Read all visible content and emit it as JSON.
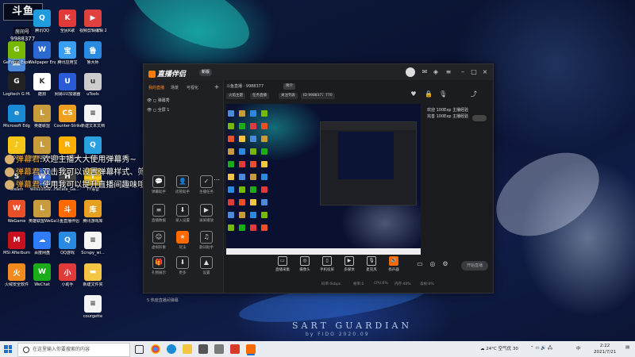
{
  "overlay": {
    "logo": "斗鱼",
    "room_label": "房间号",
    "room_number": "9988377"
  },
  "danmaku": [
    {
      "name": "弹幕君",
      "text": "欢迎主播大大使用弹幕秀~"
    },
    {
      "name": "弹幕君",
      "text": "双击我可以设置弹幕样式、筛选展示哦~"
    },
    {
      "name": "弹幕君",
      "text": "使用我可以提升直播间趣味哦(*^0^#)"
    }
  ],
  "desktop_icons": [
    {
      "label": "此电脑",
      "color": "#4a8ad8",
      "glyph": "💻"
    },
    {
      "label": "GeForce Experience",
      "color": "#76b900",
      "glyph": "G"
    },
    {
      "label": "Logitech G HUB",
      "color": "#222222",
      "glyph": "G"
    },
    {
      "label": "Microsoft Edge",
      "color": "#1a8ad4",
      "glyph": "e"
    },
    {
      "label": "QQ音乐",
      "color": "#f5c518",
      "glyph": "♪"
    },
    {
      "label": "Steam",
      "color": "#1b2838",
      "glyph": "S"
    },
    {
      "label": "WeGame",
      "color": "#e8502a",
      "glyph": "W"
    },
    {
      "label": "MSI Afterburner",
      "color": "#c8101e",
      "glyph": "M"
    },
    {
      "label": "火绒安全软件",
      "color": "#f08a1c",
      "glyph": "火"
    },
    {
      "label": "腾讯QQ",
      "color": "#1f9bde",
      "glyph": "Q"
    },
    {
      "label": "Wallpaper Engine",
      "color": "#2a6ad0",
      "glyph": "W"
    },
    {
      "label": "酷狗",
      "color": "#ffffff",
      "glyph": "K"
    },
    {
      "label": "英雄联盟",
      "color": "#c89b3c",
      "glyph": "L"
    },
    {
      "label": "英雄联盟WeGame版",
      "color": "#c89b3c",
      "glyph": "L"
    },
    {
      "label": "WIN10ISW...",
      "color": "#3b6ed8",
      "glyph": "W"
    },
    {
      "label": "英雄联盟WeGame版",
      "color": "#c89b3c",
      "glyph": "L"
    },
    {
      "label": "百度网盘",
      "color": "#2f7cf6",
      "glyph": "☁"
    },
    {
      "label": "WeChat",
      "color": "#1aad19",
      "glyph": "W"
    },
    {
      "label": "全民K歌",
      "color": "#e23a3a",
      "glyph": "K"
    },
    {
      "label": "腾讯应用宝",
      "color": "#3a9ff0",
      "glyph": "宝"
    },
    {
      "label": "网易UU加速器",
      "color": "#2a5bd7",
      "glyph": "U"
    },
    {
      "label": "Counter-Strike Global Off...",
      "color": "#f0a020",
      "glyph": "CS"
    },
    {
      "label": "Rockstar Games...",
      "color": "#fbb000",
      "glyph": "R"
    },
    {
      "label": "Hecate_Ga... Center 2.0",
      "color": "#444444",
      "glyph": "H"
    },
    {
      "label": "斗鱼直播伴侣",
      "color": "#ff6a00",
      "glyph": "斗"
    },
    {
      "label": "QQ游戏",
      "color": "#2a8ae0",
      "glyph": "Q"
    },
    {
      "label": "小助手",
      "color": "#e03a3a",
      "glyph": "小"
    },
    {
      "label": "视频剪辑编辑 20210707...",
      "color": "#e04040",
      "glyph": "▶"
    },
    {
      "label": "鲁大师",
      "color": "#2a8ae0",
      "glyph": "鲁"
    },
    {
      "label": "uTools",
      "color": "#cccccc",
      "glyph": "u"
    },
    {
      "label": "新建文本文档",
      "color": "#f4f4f4",
      "glyph": "≡"
    },
    {
      "label": "QQ",
      "color": "#2aa0e0",
      "glyph": "Q"
    },
    {
      "label": "YY语音",
      "color": "#f5c518",
      "glyph": "Y"
    },
    {
      "label": "腾讯游戏库",
      "color": "#e8a020",
      "glyph": "库"
    },
    {
      "label": "Scrspy_wi...",
      "color": "#f4f4f4",
      "glyph": "≡"
    },
    {
      "label": "新建文件夹",
      "color": "#f4c542",
      "glyph": "▬"
    },
    {
      "label": "courgette",
      "color": "#f4f4f4",
      "glyph": "≡"
    }
  ],
  "window": {
    "app_title": "直播伴侣",
    "version_badge": "新版",
    "side_tabs": [
      "我的直播",
      "场景",
      "可视化"
    ],
    "scenes": [
      "弹幕秀",
      "全屏 1"
    ],
    "tools": [
      {
        "label": "弹幕助手",
        "glyph": "💬"
      },
      {
        "label": "房管助手",
        "glyph": "👤"
      },
      {
        "label": "主播任务",
        "glyph": "✓"
      },
      {
        "label": "直播数据",
        "glyph": "≡"
      },
      {
        "label": "录入设置",
        "glyph": "⬇"
      },
      {
        "label": "录屏播放",
        "glyph": "▶"
      },
      {
        "label": "虚拟形象",
        "glyph": "☺"
      },
      {
        "label": "玩法",
        "glyph": "★"
      },
      {
        "label": "歌词助手",
        "glyph": "♫"
      },
      {
        "label": "礼物展示",
        "glyph": "🎁"
      },
      {
        "label": "更多",
        "glyph": "⬇"
      },
      {
        "label": "设置",
        "glyph": "▲"
      }
    ],
    "side_footer": "5 热度直播间弹幕",
    "room_head": "斗鱼直播 · 9988377",
    "head_chip": "简介",
    "chips": [
      "火焰主题",
      "任务直播",
      "关注列表",
      "ID 9988377",
      "770"
    ],
    "chat_lines": [
      "欢迎 100Exp 主播经验",
      "完善 100Exp 主播经验"
    ],
    "bottom_tools": [
      {
        "label": "直播采集",
        "glyph": "▭"
      },
      {
        "label": "摄像头",
        "glyph": "◎"
      },
      {
        "label": "手机投屏",
        "glyph": "▯"
      },
      {
        "label": "多媒体",
        "glyph": "▶"
      },
      {
        "label": "麦克风",
        "glyph": "🎙"
      },
      {
        "label": "扬声器",
        "glyph": "🔊"
      }
    ],
    "start_live": "开始直播",
    "status": [
      "码率:0kbps",
      "帧率:0",
      "CPU:6%",
      "内存:40%",
      "丢帧:0%"
    ]
  },
  "watermark": {
    "title": "SART GUARDIAN",
    "sub": "by FIDO 2020.09"
  },
  "taskbar": {
    "search_placeholder": "在这里输入你要搜索的内容",
    "weather": "24°C 空气优 30",
    "ime": "中",
    "time": "2:22",
    "date": "2021/7/21"
  },
  "colors": {
    "accent": "#ff6a00",
    "taskbar": "#e9ecf0"
  }
}
